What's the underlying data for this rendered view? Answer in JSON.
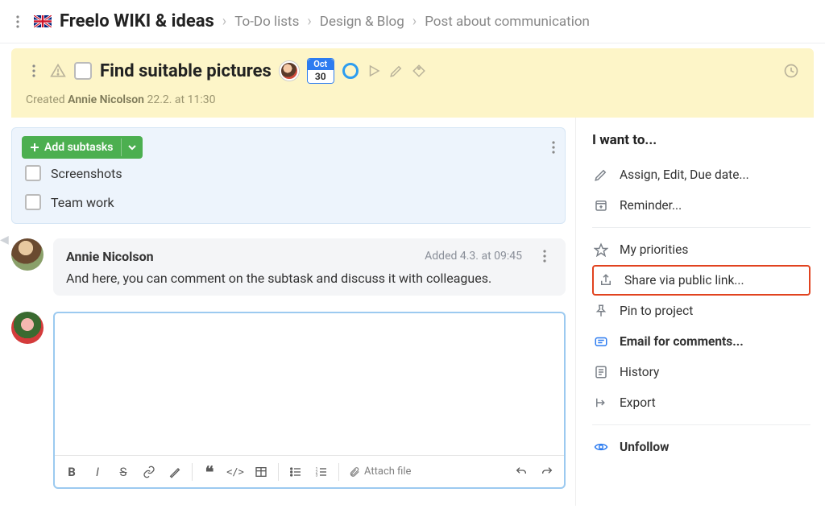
{
  "breadcrumbs": {
    "workspace": "Freelo WIKI & ideas",
    "list": "To-Do lists",
    "project": "Design & Blog",
    "task": "Post about communication"
  },
  "task": {
    "title": "Find suitable pictures",
    "due_month": "Oct",
    "due_day": "30",
    "created_prefix": "Created",
    "created_by": "Annie Nicolson",
    "created_at": "22.2. at 11:30"
  },
  "subtasks": {
    "add_label": "Add subtasks",
    "items": [
      {
        "label": "Screenshots"
      },
      {
        "label": "Team work"
      }
    ]
  },
  "comment": {
    "author": "Annie Nicolson",
    "meta": "Added 4.3. at 09:45",
    "text": "And here, you can comment on the subtask and discuss it with colleagues."
  },
  "editor": {
    "attach_label": "Attach file"
  },
  "sidebar": {
    "title": "I want to...",
    "assign": "Assign, Edit, Due date...",
    "reminder": "Reminder...",
    "priorities": "My priorities",
    "share": "Share via public link...",
    "pin": "Pin to project",
    "email": "Email for comments...",
    "history": "History",
    "export": "Export",
    "unfollow": "Unfollow"
  }
}
